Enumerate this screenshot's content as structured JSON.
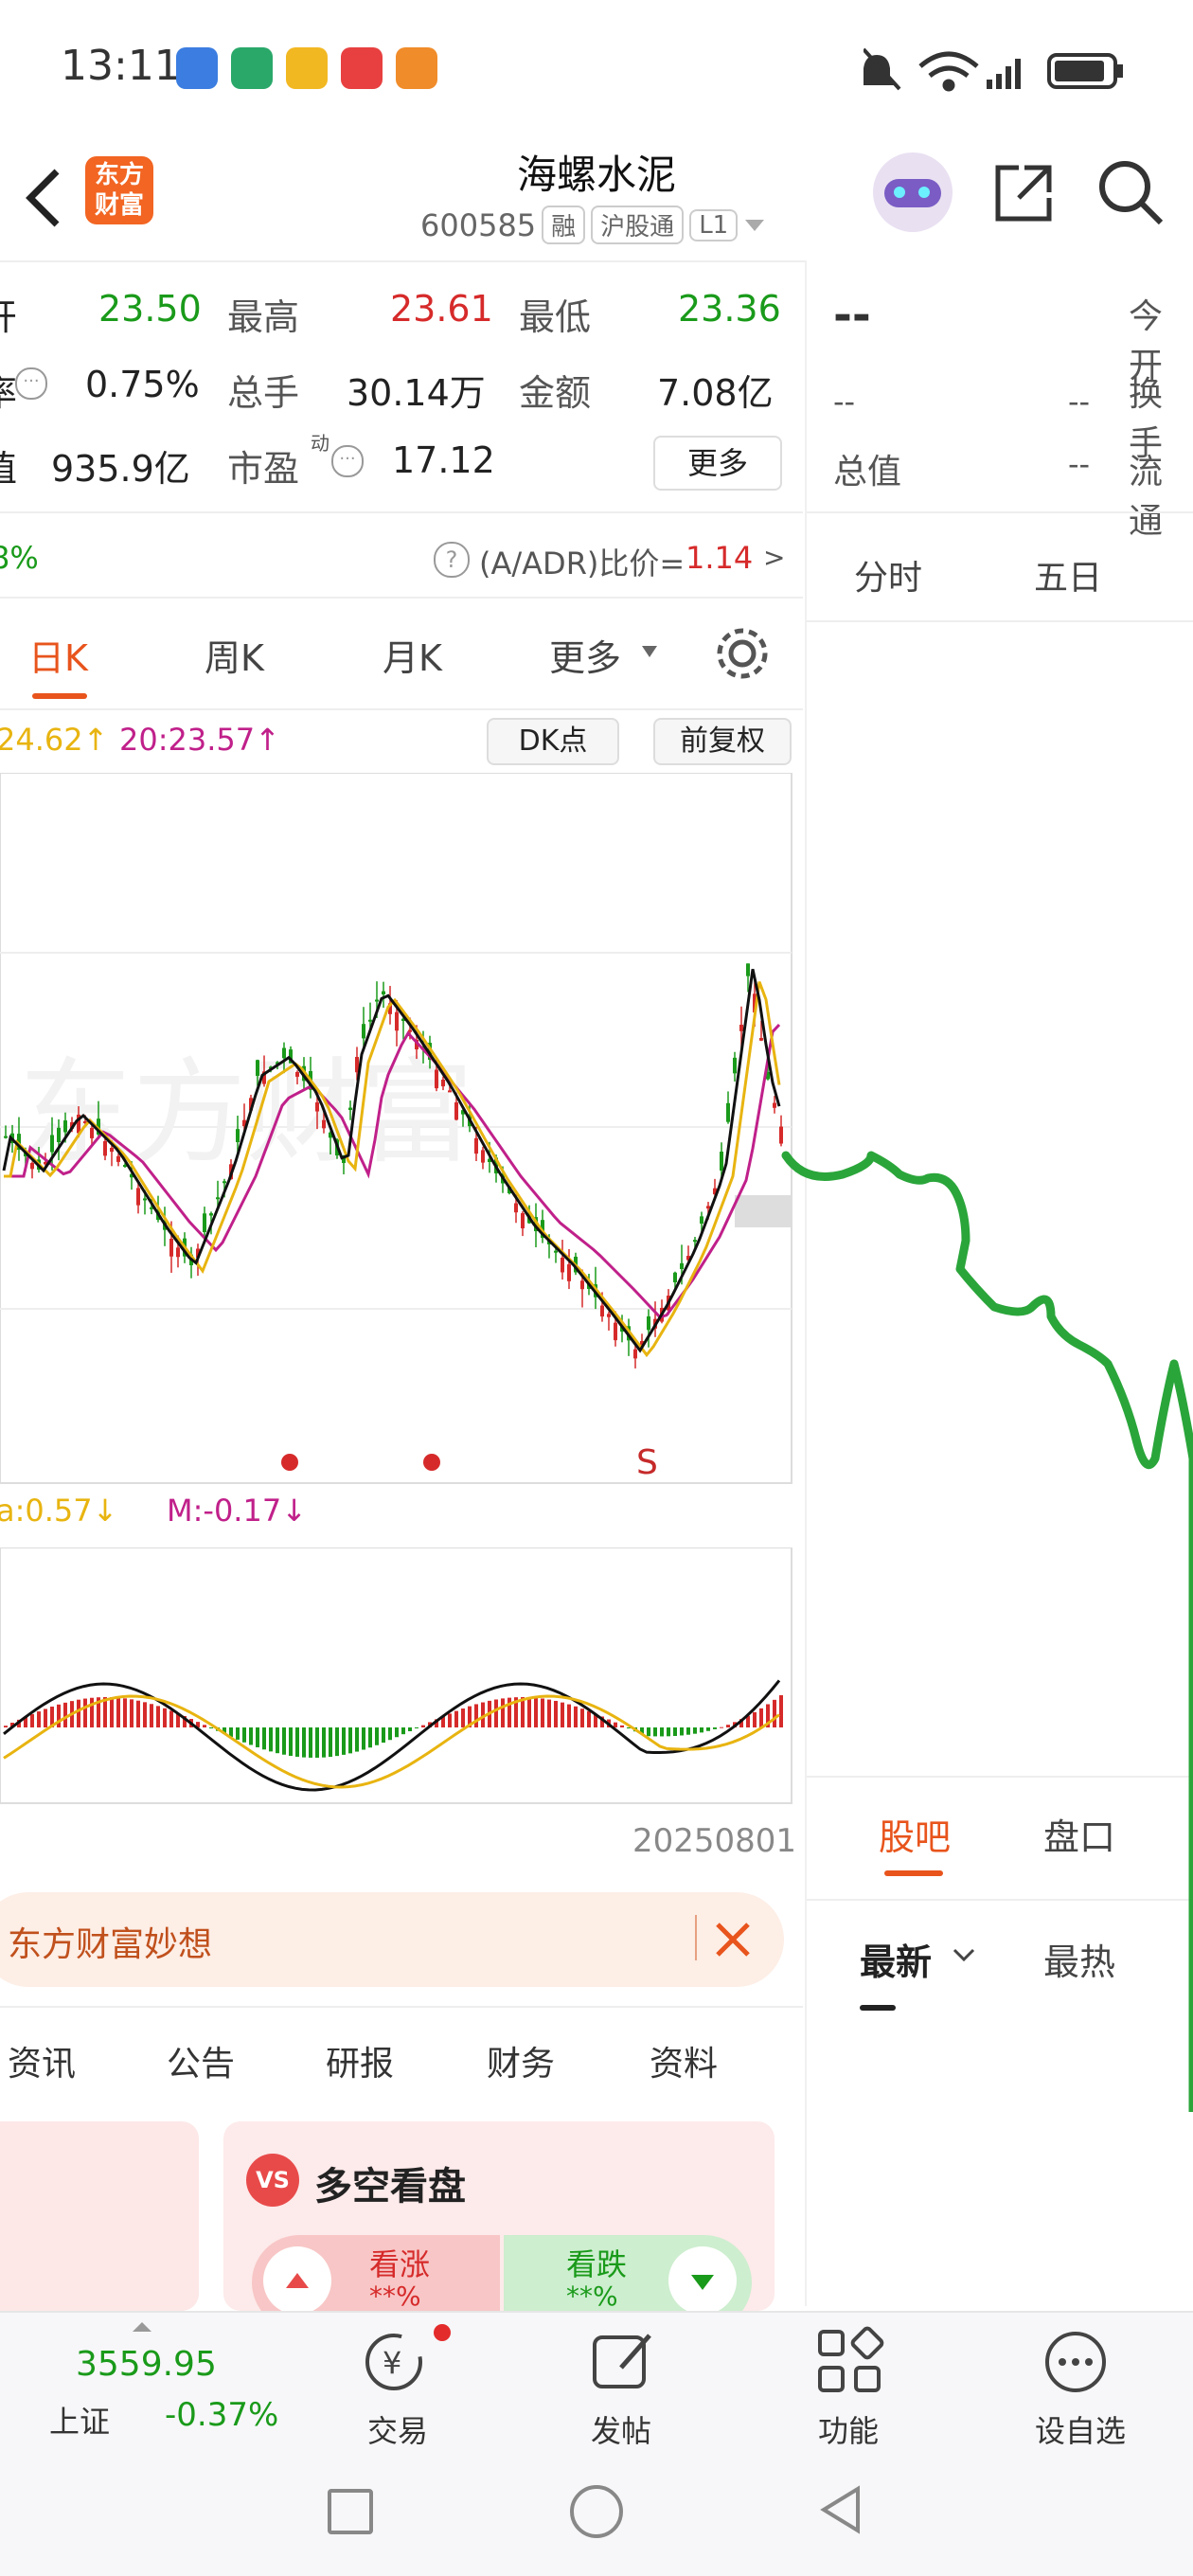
{
  "status_bar": {
    "time": "13:11"
  },
  "header": {
    "logo_text_1": "东方",
    "logo_text_2": "财富",
    "title": "海螺水泥",
    "code": "600585",
    "chips": [
      "融",
      "沪股通",
      "L1"
    ]
  },
  "quote": {
    "row1": {
      "label_a": "开",
      "val_a": "23.50",
      "label_b": "最高",
      "val_b": "23.61",
      "label_c": "最低",
      "val_c": "23.36"
    },
    "row2": {
      "label_a": "率",
      "val_a": "0.75%",
      "label_b": "总手",
      "val_b": "30.14万",
      "label_c": "金额",
      "val_c": "7.08亿"
    },
    "row3": {
      "label_a": "值",
      "val_a": "935.9亿",
      "label_b": "市盈",
      "label_b_sup": "动",
      "val_b": "17.12",
      "more": "更多"
    },
    "adr_left": "8%",
    "adr_label": "(A/ADR)比价=",
    "adr_value": "1.14"
  },
  "right_panel": {
    "dash_big": "--",
    "label_today": "今开",
    "row_dash_1": "--",
    "row_dash_2": "--",
    "label_turnover": "换手",
    "label_total": "总值",
    "row_dash_3": "--",
    "label_float": "流通",
    "tab_fenshi": "分时",
    "tab_wuri": "五日",
    "tab_guba": "股吧",
    "tab_pankou": "盘口",
    "sort_latest": "最新",
    "sort_hot": "最热"
  },
  "kline_tabs": {
    "day": "日K",
    "week": "周K",
    "month": "月K",
    "more": "更多"
  },
  "ma_legend": {
    "ma10": "24.62↑",
    "ma20": "20:23.57↑"
  },
  "chart_buttons": {
    "dk": "DK点",
    "fq": "前复权"
  },
  "chart_marker": "S",
  "macd_legend": {
    "dea": "a:0.57↓",
    "macd": "M:-0.17↓"
  },
  "date_label": "20250801",
  "banner": {
    "text": "东方财富妙想"
  },
  "info_tabs": [
    "资讯",
    "公告",
    "研报",
    "财务",
    "资料"
  ],
  "vs_card": {
    "title": "多空看盘",
    "vs": "VS",
    "bull": "看涨",
    "bear": "看跌",
    "bull_pct": "**%",
    "bear_pct": "**%"
  },
  "bottom_nav": {
    "index_value": "3559.95",
    "index_name": "上证",
    "index_change": "-0.37%",
    "trade": "交易",
    "post": "发帖",
    "func": "功能",
    "watchlist": "设自选"
  },
  "colors": {
    "up": "#d62a2a",
    "down": "#1a9a1a",
    "accent": "#e8541c",
    "ma5": "#111111",
    "ma10": "#e8b410",
    "ma20": "#c0208a"
  }
}
